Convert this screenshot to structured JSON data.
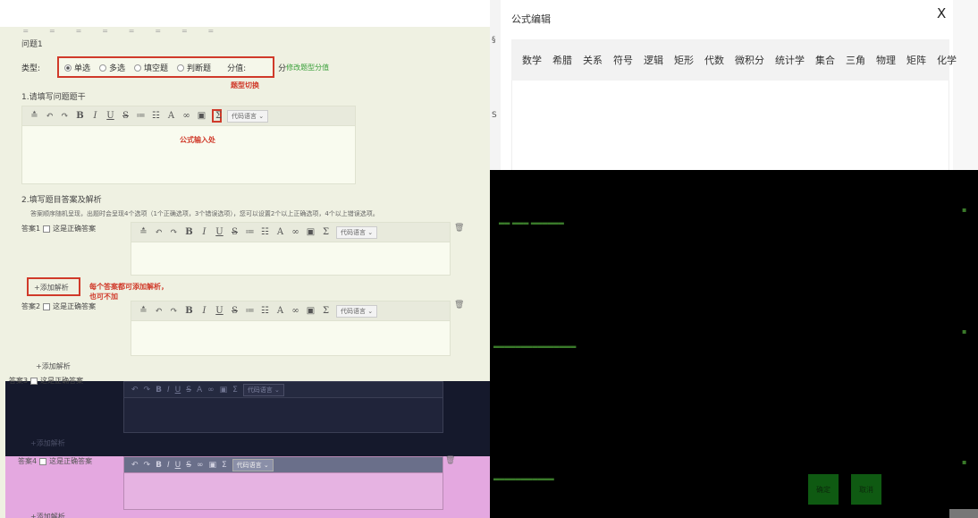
{
  "left": {
    "question_title": "问题1",
    "type_label": "类型:",
    "types": [
      "单选",
      "多选",
      "填空题",
      "判断题"
    ],
    "score_label": "分值:",
    "score_unit": "分",
    "modify_score": "修改题型分值",
    "type_switch_note": "题型切换",
    "step1": "1.请填写问题题干",
    "formula_note": "公式输入处",
    "code_lang": "代码语言",
    "step2": "2.填写题目答案及解析",
    "hint": "答案顺序随机呈现，出题时会呈现4个选项（1个正确选项，3个错误选项），您可以设置2个以上正确选项，4个以上错误选项。",
    "answers": [
      {
        "label": "答案1",
        "correct": "这是正确答案"
      },
      {
        "label": "答案2",
        "correct": "这是正确答案"
      },
      {
        "label": "答案3",
        "correct": "这是正确答案"
      },
      {
        "label": "答案4",
        "correct": "这是正确答案"
      }
    ],
    "add_parse": "+添加解析",
    "parse_note_line1": "每个答案都可添加解析，",
    "parse_note_line2": "也可不加"
  },
  "dialog": {
    "title": "公式编辑",
    "close": "X",
    "tabs": [
      "数学",
      "希腊",
      "关系",
      "符号",
      "逻辑",
      "矩形",
      "代数",
      "微积分",
      "统计学",
      "集合",
      "三角",
      "物理",
      "矩阵",
      "化学"
    ],
    "confirm": "确定",
    "cancel": "取消"
  },
  "colors": {
    "accent_red": "#d03a2a",
    "link_green": "#3aa03a",
    "panel_bg": "#eff1e2"
  }
}
